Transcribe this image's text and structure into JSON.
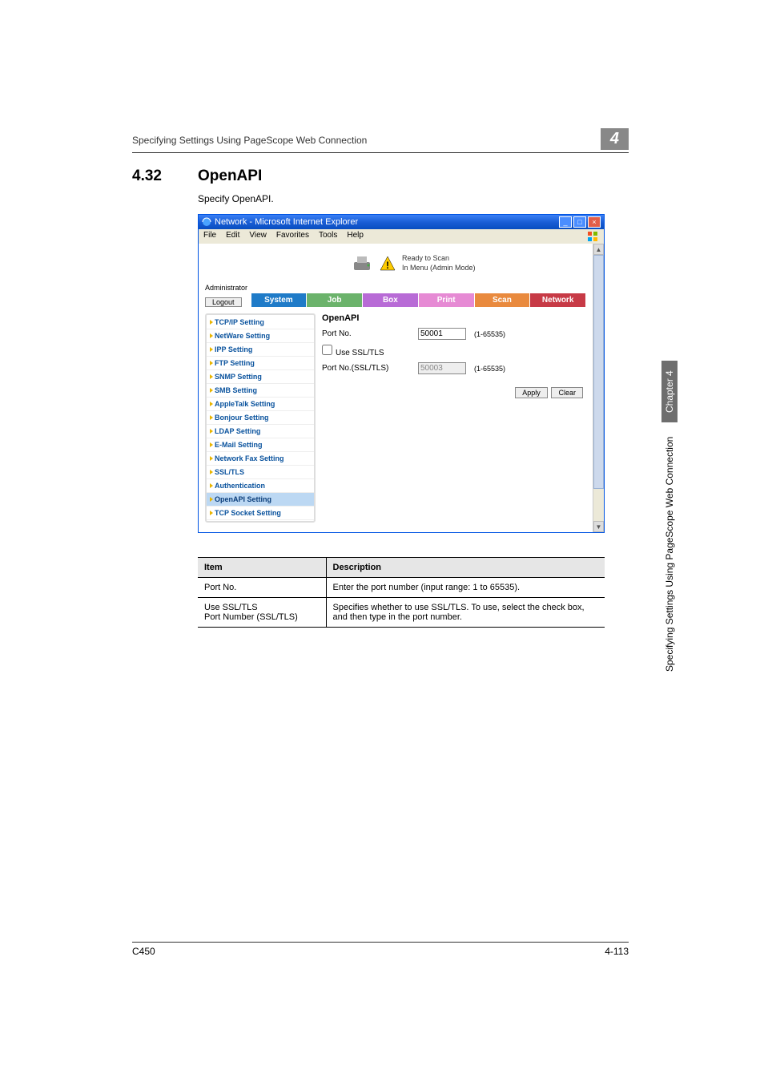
{
  "header": {
    "breadcrumb": "Specifying Settings Using PageScope Web Connection",
    "chapter_digit": "4"
  },
  "section": {
    "number": "4.32",
    "title": "OpenAPI",
    "intro": "Specify OpenAPI."
  },
  "ie": {
    "title": "Network - Microsoft Internet Explorer",
    "menu": [
      "File",
      "Edit",
      "View",
      "Favorites",
      "Tools",
      "Help"
    ],
    "status1": "Ready to Scan",
    "status2": "In Menu (Admin Mode)",
    "admin_label": "Administrator",
    "logout": "Logout",
    "tabs": [
      "System",
      "Job",
      "Box",
      "Print",
      "Scan",
      "Network"
    ],
    "selected_tab": 5,
    "sidebar": [
      "TCP/IP Setting",
      "NetWare Setting",
      "IPP Setting",
      "FTP Setting",
      "SNMP Setting",
      "SMB Setting",
      "AppleTalk Setting",
      "Bonjour Setting",
      "LDAP Setting",
      "E-Mail Setting",
      "Network Fax Setting",
      "SSL/TLS",
      "Authentication",
      "OpenAPI Setting",
      "TCP Socket Setting"
    ],
    "sidebar_selected": 13,
    "content": {
      "title": "OpenAPI",
      "port_label": "Port No.",
      "port_value": "50001",
      "port_range": "(1-65535)",
      "ssl_label": "Use SSL/TLS",
      "ssl_checked": false,
      "sslport_label": "Port No.(SSL/TLS)",
      "sslport_value": "50003",
      "sslport_range": "(1-65535)",
      "apply": "Apply",
      "clear": "Clear"
    }
  },
  "table": {
    "head_item": "Item",
    "head_desc": "Description",
    "rows": [
      {
        "item": "Port No.",
        "desc": "Enter the port number (input range: 1 to 65535)."
      },
      {
        "item": "Use SSL/TLS\nPort Number (SSL/TLS)",
        "desc": "Specifies whether to use SSL/TLS. To use, select the check box, and then type in the port number."
      }
    ]
  },
  "side": {
    "dark": "Chapter 4",
    "light": "Specifying Settings Using PageScope Web Connection"
  },
  "footer": {
    "left": "C450",
    "right": "4-113"
  }
}
